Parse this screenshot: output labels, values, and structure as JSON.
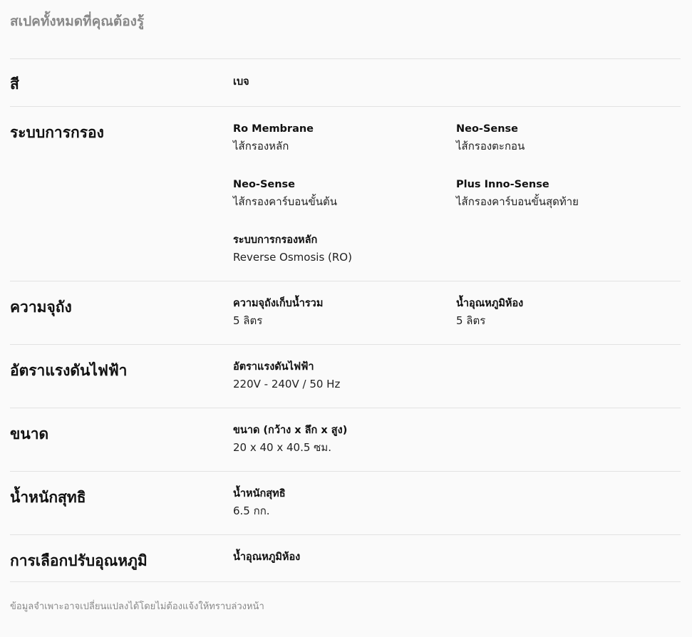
{
  "header": {
    "title": "สเปคทั้งหมดที่คุณต้องรู้"
  },
  "specs": {
    "color": {
      "label": "สี",
      "value": "เบจ"
    },
    "filter": {
      "label": "ระบบการกรอง",
      "items": [
        {
          "title": "Ro Membrane",
          "value": "ไส้กรองหลัก"
        },
        {
          "title": "Neo-Sense",
          "value": "ไส้กรองตะกอน"
        },
        {
          "title": "Neo-Sense",
          "value": "ไส้กรองคาร์บอนขั้นต้น"
        },
        {
          "title": "Plus Inno-Sense",
          "value": "ไส้กรองคาร์บอนขั้นสุดท้าย"
        },
        {
          "title": "ระบบการกรองหลัก",
          "value": "Reverse Osmosis (RO)"
        }
      ]
    },
    "capacity": {
      "label": "ความจุถัง",
      "items": [
        {
          "title": "ความจุถังเก็บน้ำรวม",
          "value": "5 ลิตร"
        },
        {
          "title": "น้ำอุณหภูมิห้อง",
          "value": "5 ลิตร"
        }
      ]
    },
    "voltage": {
      "label": "อัตราแรงดันไฟฟ้า",
      "items": [
        {
          "title": "อัตราแรงดันไฟฟ้า",
          "value": "220V - 240V / 50 Hz"
        }
      ]
    },
    "size": {
      "label": "ขนาด",
      "items": [
        {
          "title": "ขนาด (กว้าง x ลึก x สูง)",
          "value": "20 x 40 x 40.5 ซม."
        }
      ]
    },
    "weight": {
      "label": "น้ำหนักสุทธิ",
      "items": [
        {
          "title": "น้ำหนักสุทธิ",
          "value": "6.5 กก."
        }
      ]
    },
    "temperature": {
      "label": "การเลือกปรับอุณหภูมิ",
      "value": "น้ำอุณหภูมิห้อง"
    }
  },
  "footer": {
    "note": "ข้อมูลจำเพาะอาจเปลี่ยนแปลงได้โดยไม่ต้องแจ้งให้ทราบล่วงหน้า"
  }
}
